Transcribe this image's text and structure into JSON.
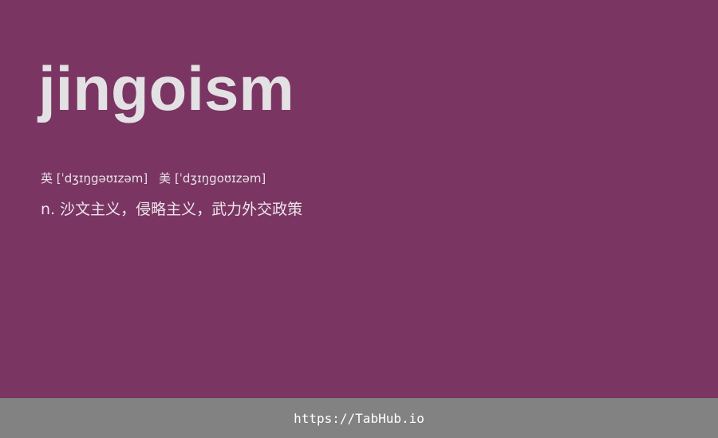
{
  "word": "jingoism",
  "phonetics": {
    "uk": "英 [ˈdʒɪŋgəʊɪzəm]",
    "us": "美 [ˈdʒɪŋgoʊɪzəm]"
  },
  "definition": "n. 沙文主义，侵略主义，武力外交政策",
  "footer": {
    "url": "https://TabHub.io"
  },
  "colors": {
    "background": "#7a3563",
    "footer": "#828282"
  }
}
